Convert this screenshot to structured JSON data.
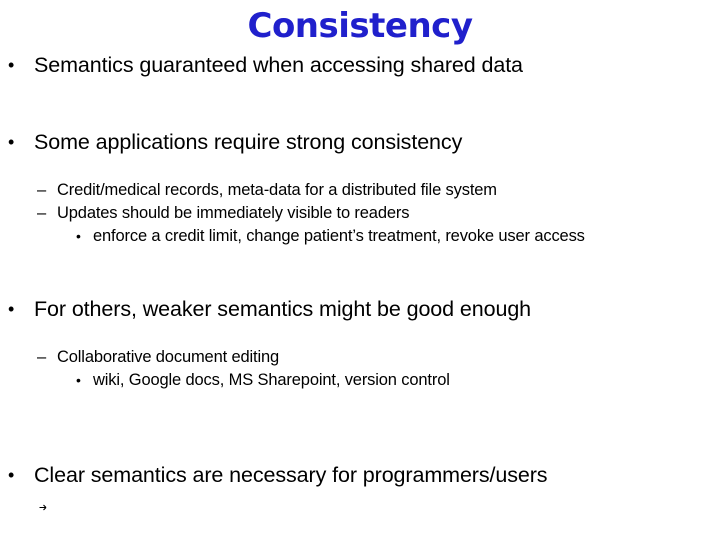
{
  "slide": {
    "title": "Consistency",
    "title_color": "#2020cc",
    "background_color": "#ffffff",
    "text_color": "#000000",
    "markers": {
      "level1": "•",
      "level2": "–",
      "level3": "•"
    },
    "bullets": [
      {
        "level": 1,
        "text": "Semantics guaranteed when accessing shared data"
      },
      {
        "level": 1,
        "text": "Some applications require strong consistency"
      },
      {
        "level": 2,
        "text": "Credit/medical records, meta-data for a distributed file system"
      },
      {
        "level": 2,
        "text": "Updates should be immediately visible to readers"
      },
      {
        "level": 3,
        "text": "enforce a credit limit, change patient’s treatment, revoke user access"
      },
      {
        "level": 1,
        "text": "For others, weaker semantics might be good enough"
      },
      {
        "level": 2,
        "text": "Collaborative document editing"
      },
      {
        "level": 3,
        "text": "wiki, Google docs, MS Sharepoint, version control"
      },
      {
        "level": 1,
        "text": "Clear semantics are necessary for programmers/users"
      }
    ]
  }
}
